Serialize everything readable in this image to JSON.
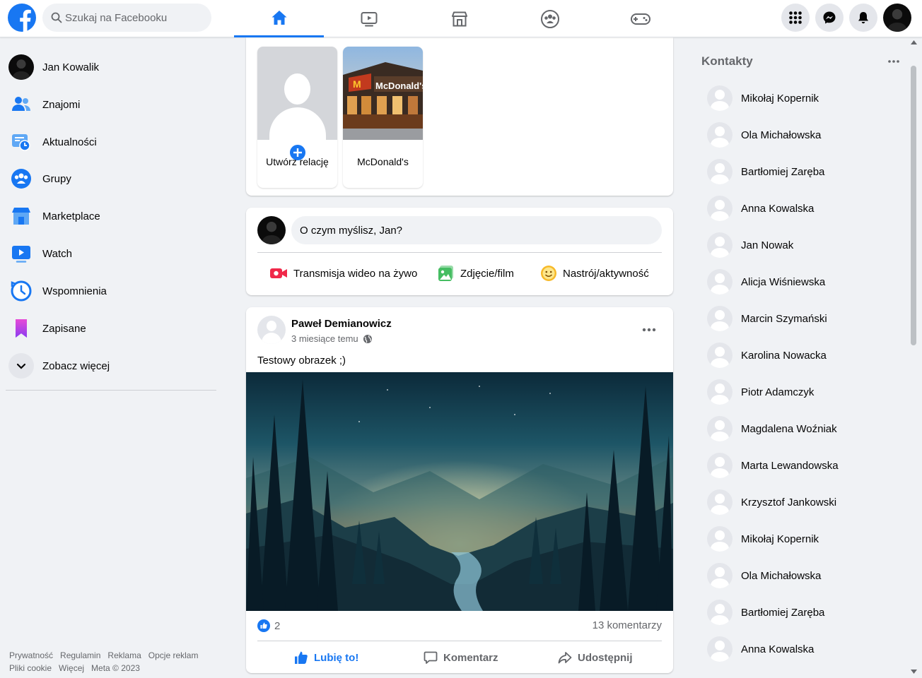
{
  "header": {
    "search_placeholder": "Szukaj na Facebooku",
    "profile_name": "Jan Kowalik",
    "nav_tabs": [
      "home-icon",
      "watch-icon",
      "marketplace-icon",
      "groups-icon",
      "gaming-icon"
    ],
    "active_tab": "home"
  },
  "sidebar": {
    "items": [
      {
        "label": "Jan Kowalik",
        "icon": "avatar"
      },
      {
        "label": "Znajomi",
        "icon": "friends-icon"
      },
      {
        "label": "Aktualności",
        "icon": "feeds-icon"
      },
      {
        "label": "Grupy",
        "icon": "groups-icon"
      },
      {
        "label": "Marketplace",
        "icon": "marketplace-icon"
      },
      {
        "label": "Watch",
        "icon": "watch-icon"
      },
      {
        "label": "Wspomnienia",
        "icon": "memories-icon"
      },
      {
        "label": "Zapisane",
        "icon": "saved-icon"
      },
      {
        "label": "Zobacz więcej",
        "icon": "chevron-down-icon"
      }
    ],
    "footer": [
      "Prywatność",
      "Regulamin",
      "Reklama",
      "Opcje reklam",
      "Pliki cookie",
      "Więcej",
      "Meta © 2023"
    ]
  },
  "stories": {
    "items": [
      {
        "label": "Utwórz relację"
      },
      {
        "label": "McDonald's",
        "sign": "McDonald's"
      }
    ]
  },
  "composer": {
    "placeholder": "O czym myślisz, Jan?",
    "actions": [
      {
        "label": "Transmisja wideo na żywo",
        "icon": "live-video-icon",
        "color": "#f02849"
      },
      {
        "label": "Zdjęcie/film",
        "icon": "photo-icon",
        "color": "#45bd62"
      },
      {
        "label": "Nastrój/aktywność",
        "icon": "feeling-icon",
        "color": "#f7b928"
      }
    ]
  },
  "post": {
    "author": "Paweł Demianowicz",
    "time": "3 miesiące temu",
    "text": "Testowy obrazek ;)",
    "likes": "2",
    "comments": "13 komentarzy",
    "actions": {
      "like": "Lubię to!",
      "comment": "Komentarz",
      "share": "Udostępnij"
    }
  },
  "contacts": {
    "title": "Kontakty",
    "items": [
      "Mikołaj Kopernik",
      "Ola Michałowska",
      "Bartłomiej Zaręba",
      "Anna Kowalska",
      "Jan Nowak",
      "Alicja Wiśniewska",
      "Marcin Szymański",
      "Karolina Nowacka",
      "Piotr Adamczyk",
      "Magdalena Woźniak",
      "Marta Lewandowska",
      "Krzysztof Jankowski",
      "Mikołaj Kopernik",
      "Ola Michałowska",
      "Bartłomiej Zaręba",
      "Anna Kowalska"
    ]
  },
  "colors": {
    "brand": "#1877f2",
    "background": "#f0f2f5",
    "secondary_text": "#65676b"
  }
}
